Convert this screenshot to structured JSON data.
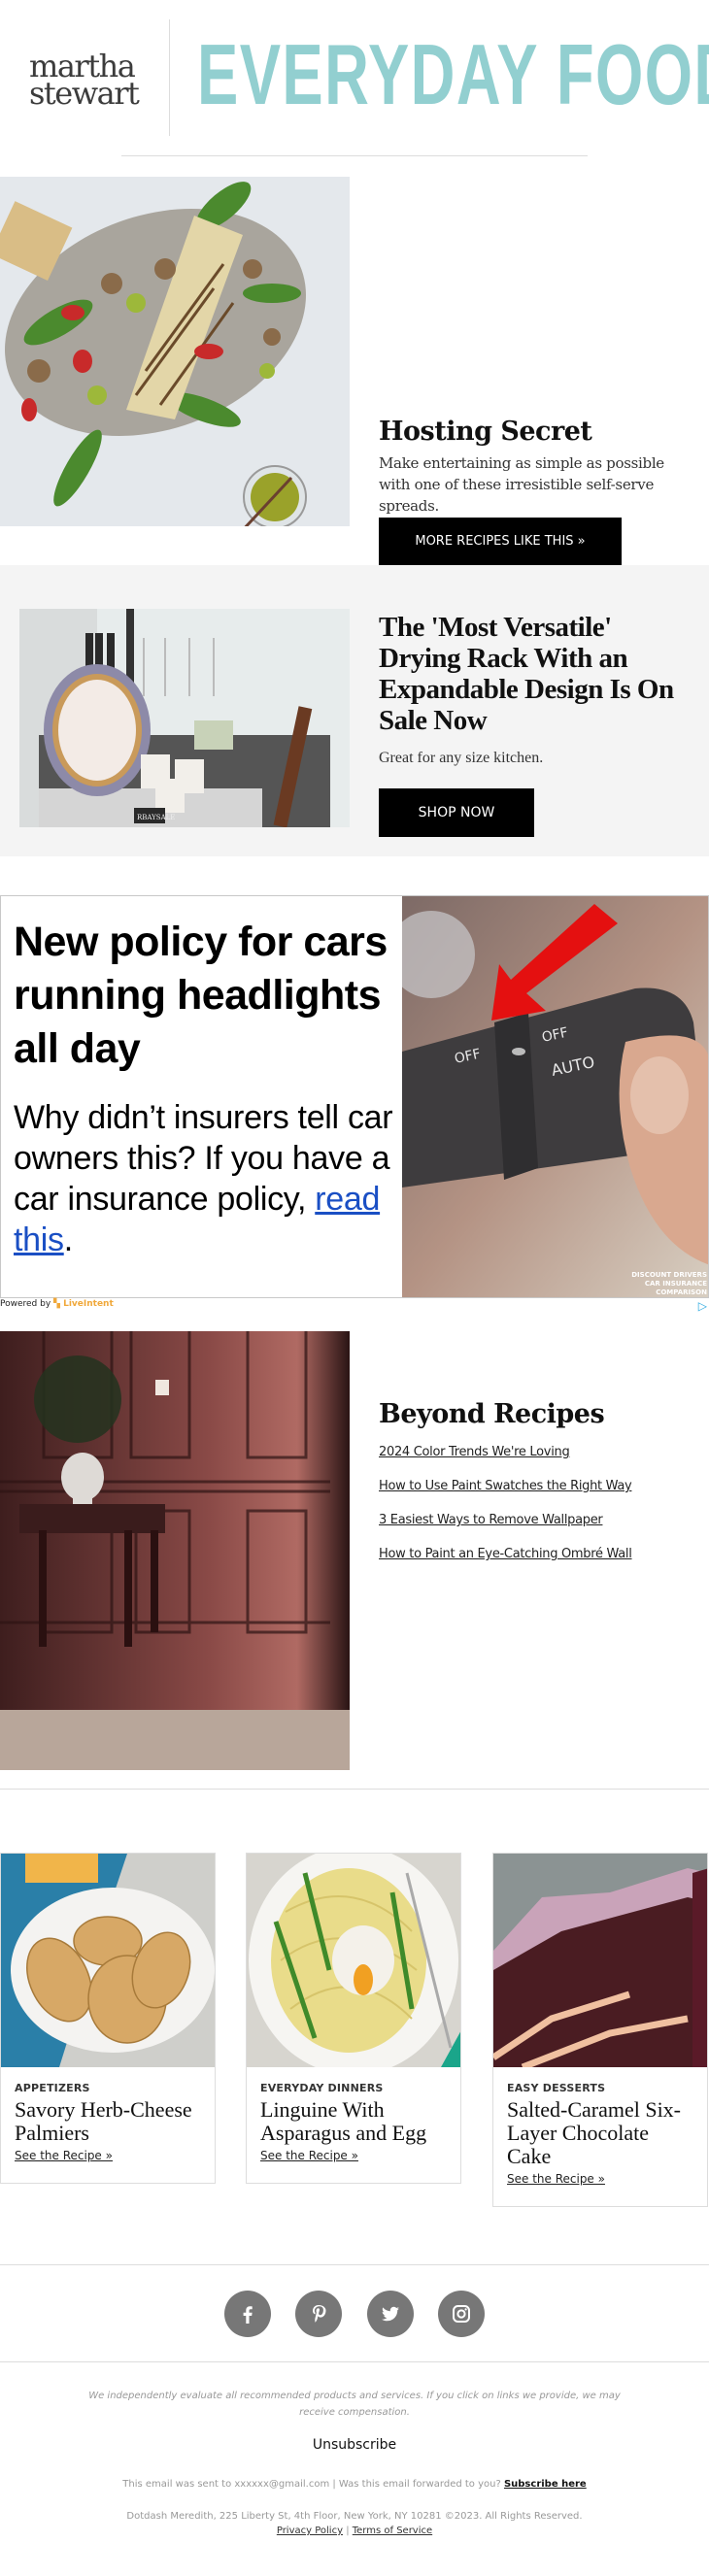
{
  "header": {
    "brand_line1": "martha",
    "brand_line2": "stewart",
    "title": "EVERYDAY FOOD",
    "title_color": "#92cfd0"
  },
  "hero": {
    "title": "Hosting Secret",
    "description": "Make entertaining as simple as possible with one of these irresistible self-serve spreads.",
    "button": "MORE RECIPES LIKE THIS »",
    "image_alt": "Grilled fish platter with vegetables and herb sauce"
  },
  "promo": {
    "title": "The 'Most Versatile' Drying Rack With an Expandable Design Is On Sale Now",
    "description": "Great for any size kitchen.",
    "button": "SHOP NOW",
    "image_alt": "Dish drying rack with plates and glasses",
    "image_brand": "RBAYSALE"
  },
  "ad": {
    "headline": "New policy for cars running headlights all day",
    "body_prefix": "Why didn’t insurers tell car owners this? If you have a car insurance policy, ",
    "link": "read this",
    "body_suffix": ".",
    "image_labels": [
      "OFF",
      "OFF",
      "AUTO"
    ],
    "image_caption": [
      "DISCOUNT DRIVERS",
      "CAR INSURANCE",
      "COMPARISON"
    ],
    "powered_by": "Powered by",
    "provider": "LiveIntent",
    "accent_color": "#f0a83a",
    "link_color": "#1a4fc4"
  },
  "beyond": {
    "title": "Beyond Recipes",
    "links": [
      "2024 Color Trends We're Loving",
      "How to Use Paint Swatches the Right Way",
      "3 Easiest Ways to Remove Wallpaper",
      "How to Paint an Eye-Catching Ombré Wall"
    ]
  },
  "cards": [
    {
      "category": "APPETIZERS",
      "title": "Savory Herb-Cheese Palmiers",
      "link": "See the Recipe »"
    },
    {
      "category": "EVERYDAY DINNERS",
      "title": "Linguine With Asparagus and Egg",
      "link": "See the Recipe »"
    },
    {
      "category": "EASY DESSERTS",
      "title": "Salted-Caramel Six-Layer Chocolate Cake",
      "link": "See the Recipe »"
    }
  ],
  "social": [
    "facebook",
    "pinterest",
    "twitter",
    "instagram"
  ],
  "footer": {
    "disclaimer": "We independently evaluate all recommended products and services. If you click on links we provide, we may receive compensation.",
    "unsubscribe": "Unsubscribe",
    "sent_to": "This email was sent to xxxxxx@gmail.com  |  Was this email forwarded to you? ",
    "subscribe": "Subscribe here",
    "address": "Dotdash Meredith, 225 Liberty St, 4th Floor, New York, NY 10281 ©2023. All Rights Reserved.",
    "privacy": "Privacy Policy",
    "separator": "|",
    "terms": "Terms of Service"
  }
}
